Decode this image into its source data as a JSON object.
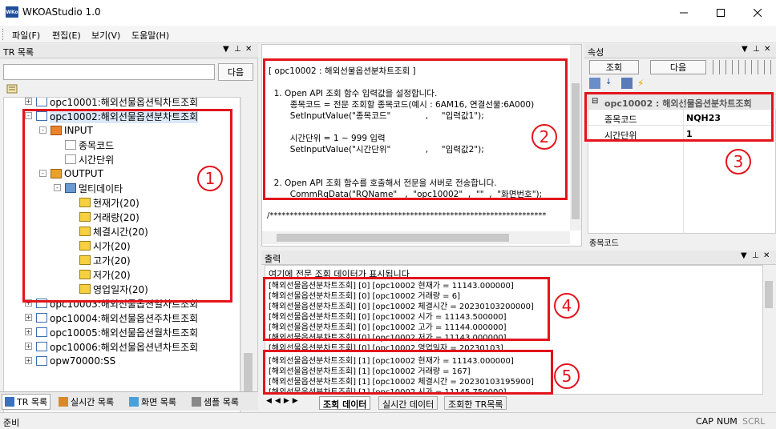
{
  "window": {
    "title": "WKOAStudio 1.0",
    "icon_text": "WKo"
  },
  "menu": [
    "파일(F)",
    "편집(E)",
    "보기(V)",
    "도움말(H)"
  ],
  "tr_panel": {
    "title": "TR 목록",
    "search_value": "",
    "next_button": "다음",
    "tree": [
      {
        "label": "opc10001:해외선물옵션틱차트조회",
        "level": 1,
        "expander": "+",
        "icon": "document-icon"
      },
      {
        "label": "opc10002:해외선물옵션분차트조회",
        "level": 1,
        "expander": "-",
        "icon": "document-icon"
      },
      {
        "label": "INPUT",
        "level": 2,
        "expander": "-",
        "icon": "pencil-icon"
      },
      {
        "label": "종목코드",
        "level": 3,
        "expander": "",
        "icon": "field-icon"
      },
      {
        "label": "시간단위",
        "level": 3,
        "expander": "",
        "icon": "field-icon"
      },
      {
        "label": "OUTPUT",
        "level": 2,
        "expander": "-",
        "icon": "tag-icon"
      },
      {
        "label": "멀티데이타",
        "level": 3,
        "expander": "-",
        "icon": "grid-icon"
      },
      {
        "label": "현재가(20)",
        "level": 4,
        "expander": "",
        "icon": "field-yellow-icon"
      },
      {
        "label": "거래량(20)",
        "level": 4,
        "expander": "",
        "icon": "field-yellow-icon"
      },
      {
        "label": "체결시간(20)",
        "level": 4,
        "expander": "",
        "icon": "field-yellow-icon"
      },
      {
        "label": "시가(20)",
        "level": 4,
        "expander": "",
        "icon": "field-yellow-icon"
      },
      {
        "label": "고가(20)",
        "level": 4,
        "expander": "",
        "icon": "field-yellow-icon"
      },
      {
        "label": "저가(20)",
        "level": 4,
        "expander": "",
        "icon": "field-yellow-icon"
      },
      {
        "label": "영업일자(20)",
        "level": 4,
        "expander": "",
        "icon": "field-yellow-icon"
      },
      {
        "label": "opc10003:해외선물옵션일차트조회",
        "level": 1,
        "expander": "+",
        "icon": "document-icon"
      },
      {
        "label": "opc10004:해외선물옵션주차트조회",
        "level": 1,
        "expander": "+",
        "icon": "document-icon"
      },
      {
        "label": "opc10005:해외선물옵션월차트조회",
        "level": 1,
        "expander": "+",
        "icon": "document-icon"
      },
      {
        "label": "opc10006:해외선물옵션년차트조회",
        "level": 1,
        "expander": "+",
        "icon": "document-icon"
      },
      {
        "label": "opw70000:SS",
        "level": 1,
        "expander": "+",
        "icon": "document-icon"
      }
    ],
    "bottom_tabs": [
      "TR 목록",
      "실시간 목록",
      "화면 목록",
      "샘플 목록"
    ]
  },
  "code_panel": {
    "lines": [
      "[ opc10002 : 해외선물옵션분차트조회 ]",
      "",
      "  1. Open API 조회 함수 입력값을 설정합니다.",
      "        종목코드 = 전문 조회할 종목코드(예시 : 6AM16, 연결선물:6A000)",
      "        SetInputValue(\"종목코드\"             ,     \"입력값1\");",
      "",
      "        시간단위 = 1 ~ 999 입력",
      "        SetInputValue(\"시간단위\"             ,     \"입력값2\");",
      "",
      "",
      "  2. Open API 조회 함수를 호출해서 전문을 서버로 전송합니다.",
      "        CommRqData(\"RQName\"   ,  \"opc10002\"  ,  \"\"  ,  \"화면번호\");"
    ],
    "separator": "/*********************************************************************"
  },
  "properties_panel": {
    "title": "속성",
    "buttons": [
      "조회",
      "다음"
    ],
    "group": "opc10002 : 해외선물옵션분차트조회",
    "rows": [
      {
        "key": "종목코드",
        "value": "NQH23"
      },
      {
        "key": "시간단위",
        "value": "1"
      }
    ],
    "footer_label": "종목코드"
  },
  "output_panel": {
    "title": "출력",
    "header_line": "여기에 전문 조회 데이터가 표시됩니다",
    "lines": [
      "[해외선물옵션분차트조회] [0] [opc10002 현재가 = 11143.000000]",
      "[해외선물옵션분차트조회] [0] [opc10002 거래량 = 6]",
      "[해외선물옵션분차트조회] [0] [opc10002 체결시간 = 20230103200000]",
      "[해외선물옵션분차트조회] [0] [opc10002 시가 = 11143.500000]",
      "[해외선물옵션분차트조회] [0] [opc10002 고가 = 11144.000000]",
      "[해외선물옵션분차트조회] [0] [opc10002 저가 = 11143.000000]",
      "[해외선물옵션분차트조회] [0] [opc10002 영업일자 = 20230103]",
      "[해외선물옵션분차트조회] [1] [opc10002 현재가 = 11143.000000]",
      "[해외선물옵션분차트조회] [1] [opc10002 거래량 = 167]",
      "[해외선물옵션분차트조회] [1] [opc10002 체결시간 = 20230103195900]",
      "[해외선물옵션분차트조회] [1] [opc10002 시가 = 11145.750000]"
    ],
    "tabs": [
      "조회 데이터",
      "실시간 데이터",
      "조회한 TR목록"
    ]
  },
  "status_bar": {
    "left": "준비",
    "indicators": [
      "CAP",
      "NUM",
      "SCRL"
    ]
  },
  "annotations": [
    "1",
    "2",
    "3",
    "4",
    "5"
  ]
}
